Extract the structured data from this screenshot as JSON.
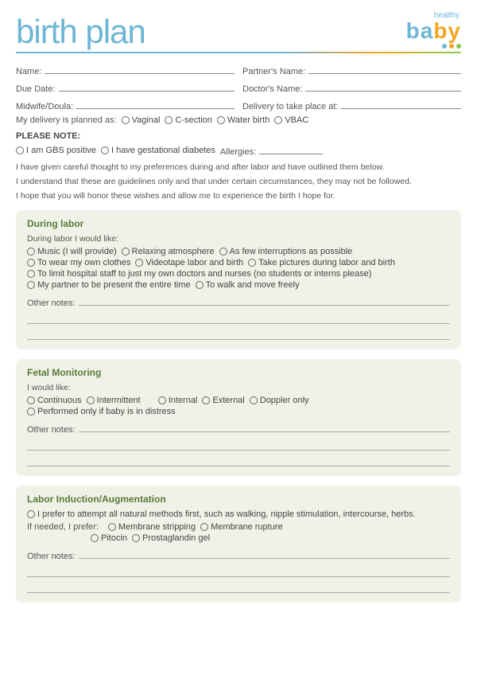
{
  "header": {
    "title": "birth plan",
    "logo_healthy": "healthy",
    "logo_baby_main": "ba",
    "logo_baby_accent": "by",
    "dots": [
      "#6db6d4",
      "#f5a623",
      "#8cc84b"
    ]
  },
  "form": {
    "name_label": "Name:",
    "partners_name_label": "Partner's Name:",
    "due_date_label": "Due Date:",
    "doctors_name_label": "Doctor's Name:",
    "midwife_label": "Midwife/Doula:",
    "delivery_place_label": "Delivery to take place at:",
    "delivery_planned_label": "My delivery is planned as:",
    "delivery_options": [
      "Vaginal",
      "C-section",
      "Water birth",
      "VBAC"
    ]
  },
  "please_note": {
    "title": "PLEASE NOTE:",
    "gbs_label": "I am GBS positive",
    "diabetes_label": "I have gestational diabetes",
    "allergies_label": "Allergies:"
  },
  "intro_paragraphs": [
    "I have given careful thought to my preferences during and after labor and have outlined them below.",
    "I understand that these are guidelines only and that under certain circumstances, they may not be followed.",
    "I hope that you will honor these wishes and allow me to experience the birth I hope for."
  ],
  "sections": [
    {
      "id": "during-labor",
      "title": "During labor",
      "subtitle": "During labor I would like:",
      "options_rows": [
        [
          "Music (I will provide)",
          "Relaxing atmosphere",
          "As few interruptions as possible"
        ],
        [
          "To wear my own clothes",
          "Videotape labor and birth",
          "Take pictures during labor and birth"
        ],
        [
          "To limit hospital staff to just my own doctors and nurses (no students or interns please)"
        ],
        [
          "My partner to be present the entire time",
          "To walk and move freely"
        ]
      ],
      "other_notes_label": "Other notes:"
    },
    {
      "id": "fetal-monitoring",
      "title": "Fetal Monitoring",
      "subtitle": "I would like:",
      "options_rows": [
        [
          "Continuous",
          "Intermittent",
          "Internal",
          "External",
          "Doppler only"
        ],
        [
          "Performed only if baby is in distress"
        ]
      ],
      "other_notes_label": "Other notes:"
    },
    {
      "id": "labor-induction",
      "title": "Labor Induction/Augmentation",
      "subtitle": null,
      "intro_line": "I prefer to attempt all natural methods first, such as walking, nipple stimulation, intercourse, herbs.",
      "if_needed_label": "If needed, I prefer:",
      "options_rows": [
        [
          "Membrane stripping",
          "Membrane rupture"
        ],
        [
          "Pitocin",
          "Prostaglandin gel"
        ]
      ],
      "other_notes_label": "Other notes:"
    }
  ]
}
